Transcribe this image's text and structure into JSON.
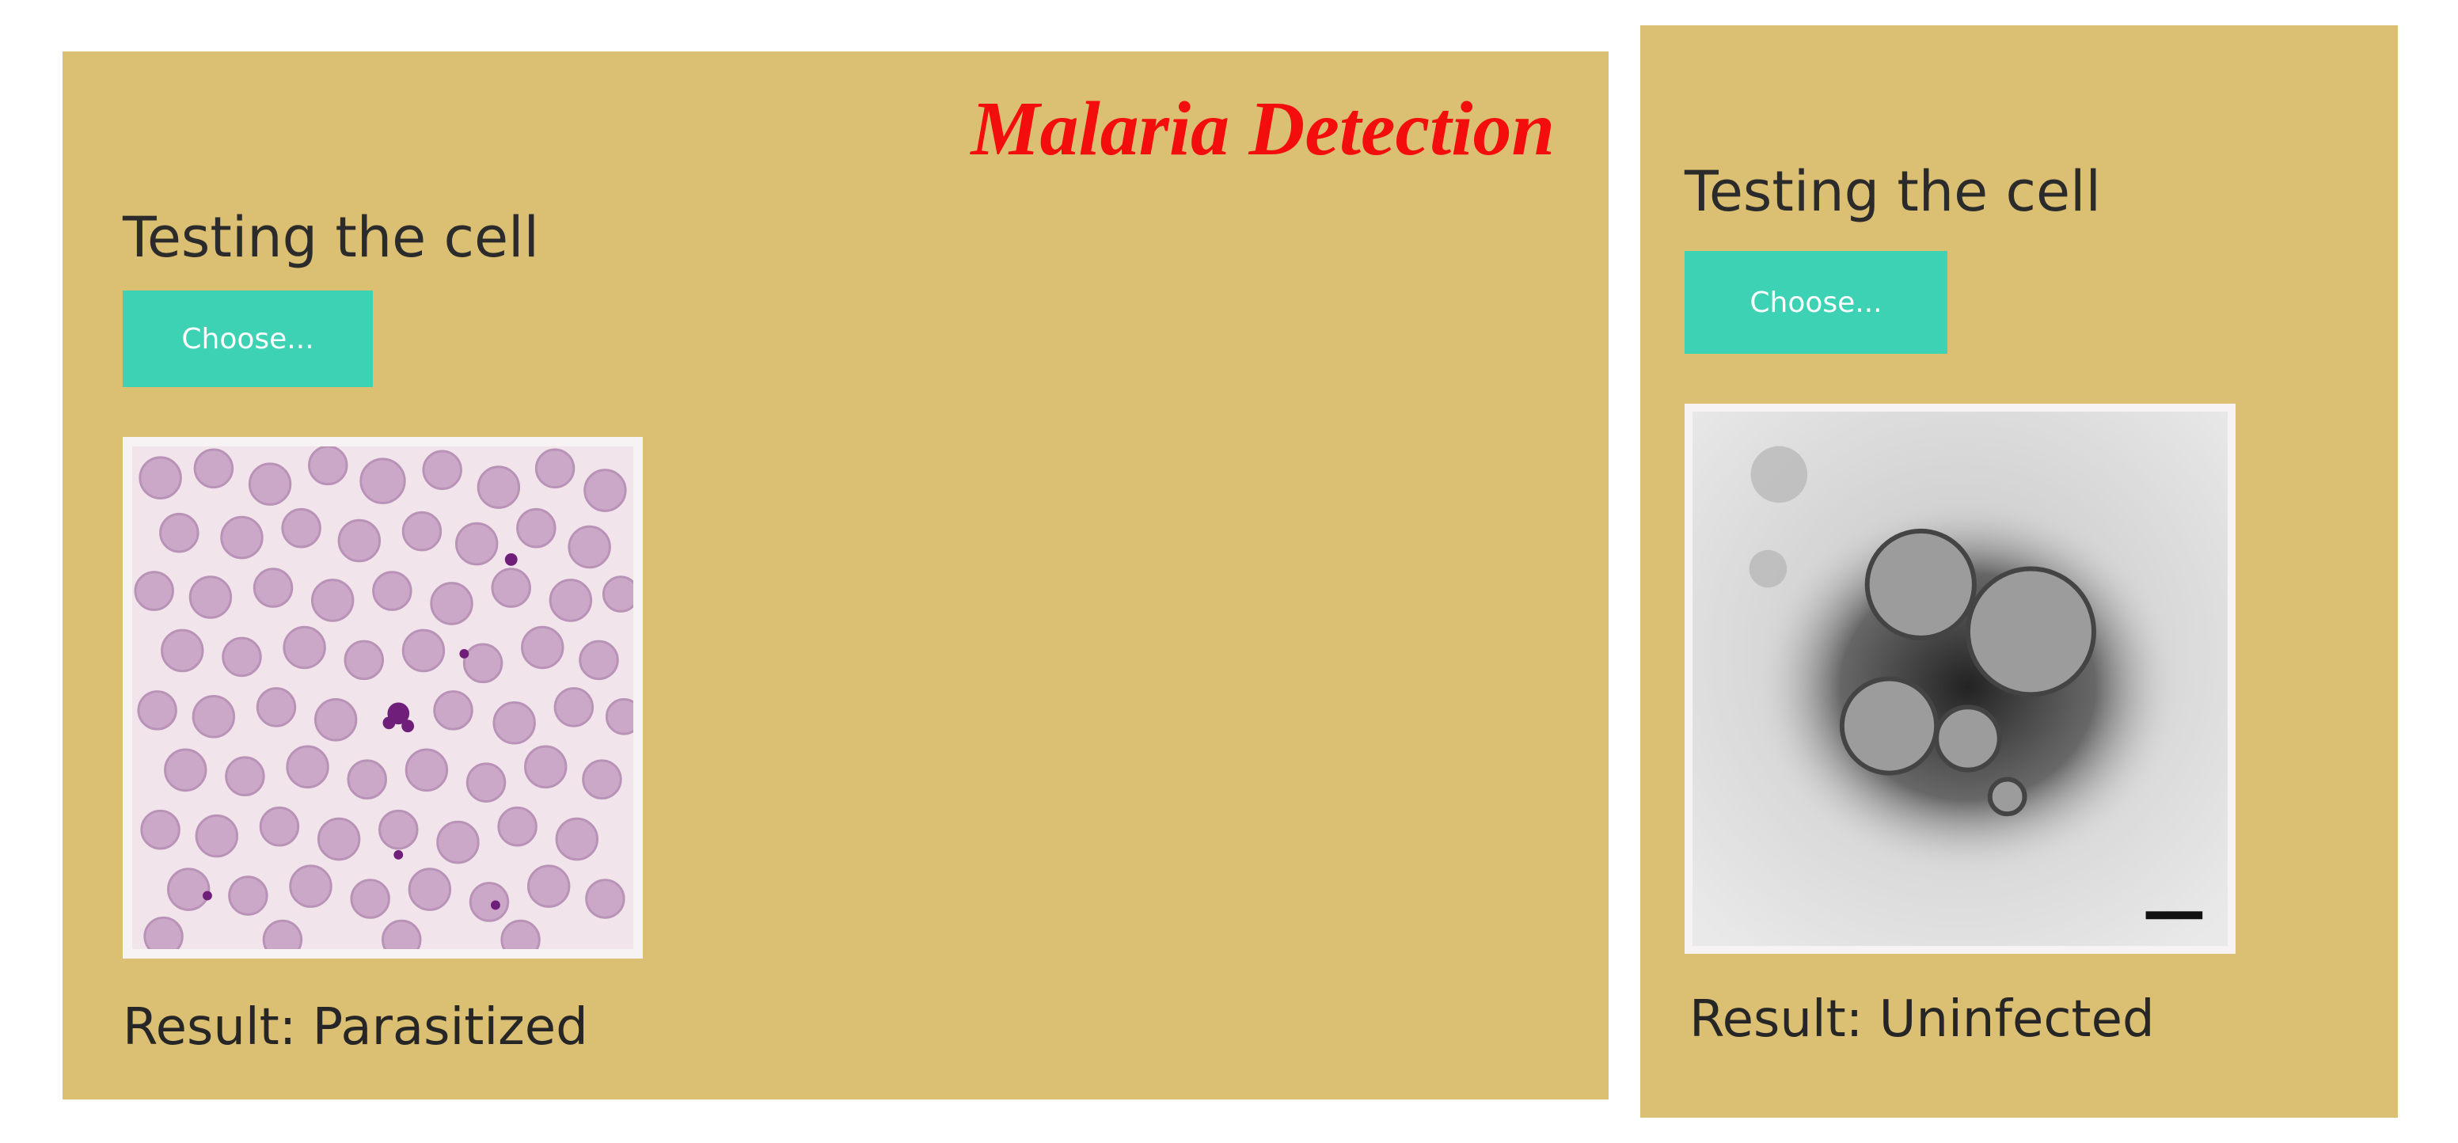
{
  "left_panel": {
    "app_title": "Malaria Detection",
    "heading": "Testing the cell",
    "choose_label": "Choose...",
    "image_description_icon": "blood-smear-image",
    "result_text": "Result: Parasitized"
  },
  "right_panel": {
    "heading": "Testing the cell",
    "choose_label": "Choose...",
    "image_description_icon": "virus-micrograph-image",
    "result_text": "Result: Uninfected"
  },
  "colors": {
    "panel_background": "#dbbf72",
    "title_red": "#f40d0d",
    "button_teal": "#3dd2b4"
  }
}
